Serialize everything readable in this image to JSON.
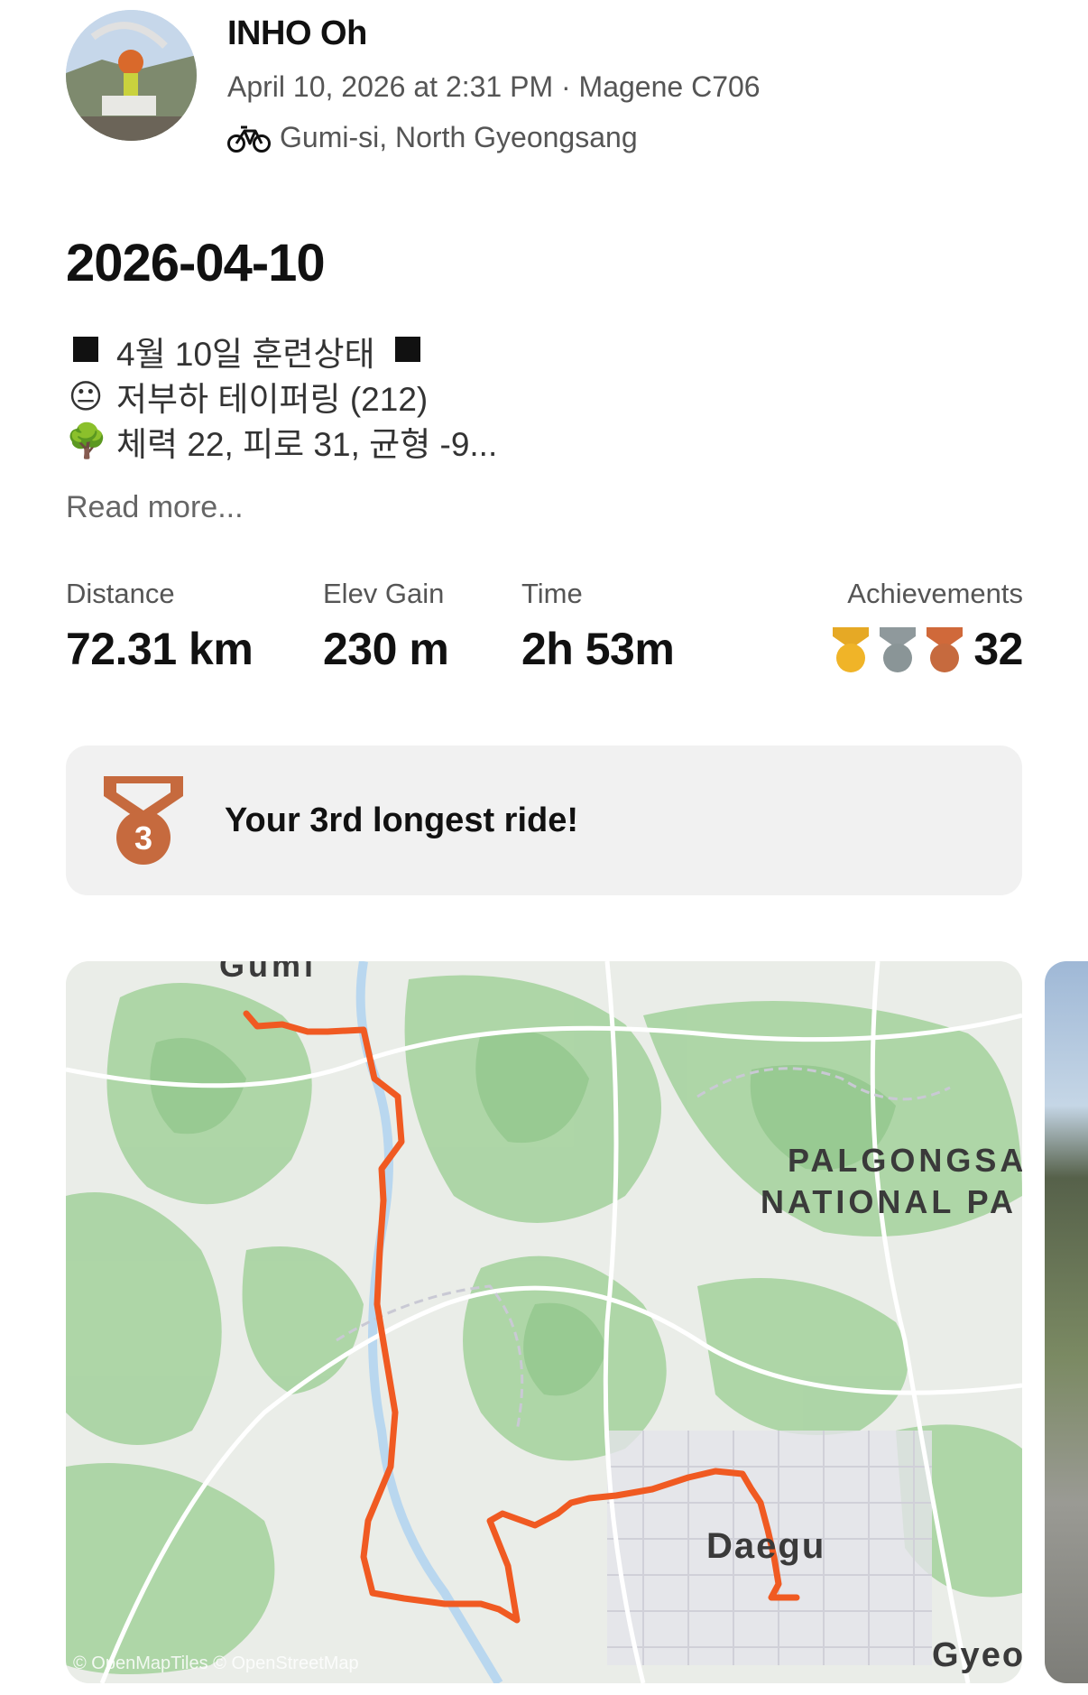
{
  "athlete": {
    "name": "INHO Oh",
    "meta": "April 10, 2026 at 2:31 PM · Magene C706",
    "location": "Gumi-si, North Gyeongsang",
    "sport_icon": "bike-icon"
  },
  "activity": {
    "title": "2026-04-10",
    "description": [
      {
        "icon": "black-square-icon",
        "text": "4월 10일 훈련상태",
        "trail_icon": "black-square-icon"
      },
      {
        "icon": "neutral-face-emoji",
        "glyph": "😐",
        "text": "저부하 테이퍼링 (212)"
      },
      {
        "icon": "tree-emoji",
        "glyph": "🌳",
        "text": "체력 22, 피로 31, 균형 -9..."
      }
    ],
    "read_more": "Read more..."
  },
  "stats": [
    {
      "label": "Distance",
      "value": "72.31 km"
    },
    {
      "label": "Elev Gain",
      "value": "230 m"
    },
    {
      "label": "Time",
      "value": "2h 53m"
    }
  ],
  "achievements": {
    "label": "Achievements",
    "count": "32",
    "medal_icons": [
      "gold-medal-icon",
      "silver-medal-icon",
      "bronze-medal-icon"
    ]
  },
  "highlight": {
    "text": "Your 3rd longest ride!",
    "medal_number": "3"
  },
  "map": {
    "labels": {
      "top_city": "Gumi",
      "park_line1": "PALGONGSA",
      "park_line2": "NATIONAL PA",
      "city": "Daegu",
      "corner": "Gyeo"
    },
    "attribution": "© OpenMapTiles © OpenStreetMap",
    "route_color": "#f05a22"
  }
}
